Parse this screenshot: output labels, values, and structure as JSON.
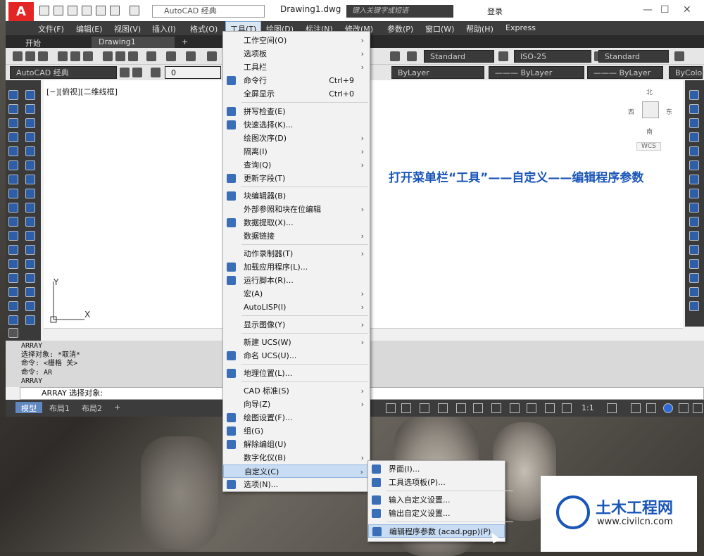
{
  "app": {
    "logo": "A",
    "workspace": "AutoCAD 经典",
    "file_title": "Drawing1.dwg",
    "search_placeholder": "键入关键字或短语",
    "login": "登录"
  },
  "menubar": {
    "items": [
      "文件(F)",
      "编辑(E)",
      "视图(V)",
      "插入(I)",
      "格式(O)",
      "工具(T)",
      "绘图(D)",
      "标注(N)",
      "修改(M)",
      "参数(P)",
      "窗口(W)",
      "帮助(H)",
      "Express"
    ],
    "active": "工具(T)"
  },
  "tabs": {
    "start": "开始",
    "doc": "Drawing1",
    "close": "×",
    "add": "+"
  },
  "toolbar": {
    "text_style": "Standard",
    "dim_style": "ISO-25",
    "table_style": "Standard",
    "workspace2": "AutoCAD 经典",
    "layer": "0",
    "color": "ByLayer",
    "linetype": "——— ByLayer",
    "lineweight": "——— ByLayer",
    "plotstyle": "ByColor"
  },
  "viewport": {
    "label": "[−][俯视][二维线框]",
    "north": "北",
    "south": "南",
    "east": "东",
    "west": "西",
    "ucs": "WCS",
    "axis_x": "X",
    "axis_y": "Y"
  },
  "annotation": "打开菜单栏“工具”——自定义——编辑程序参数",
  "command": {
    "history": [
      "ARRAY",
      "选择对象: *取消*",
      "命令:  <栅格 关>",
      "命令: AR",
      "ARRAY"
    ],
    "prompt": "ARRAY 选择对象:"
  },
  "layout_tabs": [
    "模型",
    "布局1",
    "布局2",
    "+"
  ],
  "status": {
    "scale": "1:1"
  },
  "tools_menu": [
    {
      "label": "工作空间(O)",
      "arrow": true
    },
    {
      "label": "选项板",
      "arrow": true
    },
    {
      "label": "工具栏",
      "arrow": true
    },
    {
      "label": "命令行",
      "shortcut": "Ctrl+9",
      "icon": "cmdline-icon"
    },
    {
      "label": "全屏显示",
      "shortcut": "Ctrl+0"
    },
    {
      "sep": true
    },
    {
      "label": "拼写检查(E)",
      "icon": "spellcheck-icon"
    },
    {
      "label": "快速选择(K)...",
      "icon": "quickselect-icon"
    },
    {
      "label": "绘图次序(D)",
      "arrow": true
    },
    {
      "label": "隔离(I)",
      "arrow": true
    },
    {
      "label": "查询(Q)",
      "arrow": true
    },
    {
      "label": "更新字段(T)",
      "icon": "field-icon"
    },
    {
      "sep": true
    },
    {
      "label": "块编辑器(B)",
      "icon": "blockedit-icon"
    },
    {
      "label": "外部参照和块在位编辑",
      "arrow": true
    },
    {
      "label": "数据提取(X)...",
      "icon": "dataextract-icon"
    },
    {
      "label": "数据链接",
      "arrow": true
    },
    {
      "sep": true
    },
    {
      "label": "动作录制器(T)",
      "arrow": true
    },
    {
      "label": "加载应用程序(L)...",
      "icon": "loadapp-icon"
    },
    {
      "label": "运行脚本(R)...",
      "icon": "script-icon"
    },
    {
      "label": "宏(A)",
      "arrow": true
    },
    {
      "label": "AutoLISP(I)",
      "arrow": true
    },
    {
      "sep": true
    },
    {
      "label": "显示图像(Y)",
      "arrow": true
    },
    {
      "sep": true
    },
    {
      "label": "新建 UCS(W)",
      "arrow": true
    },
    {
      "label": "命名 UCS(U)...",
      "icon": "ucs-icon"
    },
    {
      "sep": true
    },
    {
      "label": "地理位置(L)...",
      "icon": "geo-icon"
    },
    {
      "sep": true
    },
    {
      "label": "CAD 标准(S)",
      "arrow": true
    },
    {
      "label": "向导(Z)",
      "arrow": true
    },
    {
      "label": "绘图设置(F)...",
      "icon": "drafting-icon"
    },
    {
      "label": "组(G)",
      "icon": "group-icon"
    },
    {
      "label": "解除编组(U)",
      "icon": "ungroup-icon"
    },
    {
      "label": "数字化仪(B)",
      "arrow": true
    },
    {
      "label": "自定义(C)",
      "arrow": true,
      "highlight": true
    },
    {
      "label": "选项(N)...",
      "icon": "options-icon"
    }
  ],
  "customize_menu": [
    {
      "label": "界面(I)...",
      "icon": "cui-icon"
    },
    {
      "label": "工具选项板(P)...",
      "icon": "palette-icon"
    },
    {
      "sep": true
    },
    {
      "label": "输入自定义设置...",
      "icon": "import-icon"
    },
    {
      "label": "输出自定义设置...",
      "icon": "export-icon"
    },
    {
      "sep": true
    },
    {
      "label": "编辑程序参数 (acad.pgp)(P)",
      "icon": "pgp-icon",
      "highlight": true
    }
  ],
  "watermark": {
    "name": "土木工程网",
    "url": "www.civilcn.com"
  }
}
